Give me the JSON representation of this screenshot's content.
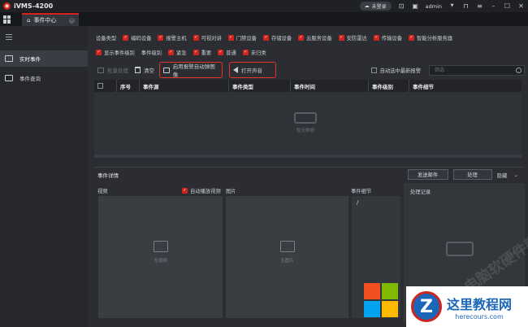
{
  "app": {
    "title": "iVMS-4200",
    "logo": "hikvision-logo"
  },
  "titlebar": {
    "login_label": "未登录",
    "user": "admin"
  },
  "tab": {
    "label": "事件中心"
  },
  "sidebar": {
    "items": [
      {
        "label": "实时事件",
        "active": true
      },
      {
        "label": "事件查询",
        "active": false
      }
    ]
  },
  "filters": {
    "device_label": "设备类型",
    "device_types": [
      "编码设备",
      "报警主机",
      "可视对讲",
      "门禁设备",
      "存储设备",
      "云服务设备",
      "安防雷达",
      "传输设备",
      "智能分析服务器"
    ],
    "level_label": "显示事件级别",
    "level_title": "事件级别",
    "levels": [
      "紧急",
      "重要",
      "普通",
      "未归类"
    ]
  },
  "toolbar": {
    "batch_handle": "批量处理",
    "clear": "清空",
    "auto_popup": "启用报警自动弹图像",
    "open_sound": "打开声音",
    "auto_select_latest": "自动选中最新报警",
    "search_placeholder": "筛选"
  },
  "table": {
    "columns": [
      "序号",
      "事件源",
      "事件类型",
      "事件时间",
      "事件级别",
      "事件细节"
    ],
    "empty_text": "暂无数据"
  },
  "detail": {
    "title": "事件详情",
    "send_email": "发送邮件",
    "handle": "处理",
    "hide": "隐藏",
    "video_label": "视频",
    "auto_play_label": "自动播放视频",
    "picture_label": "图片",
    "detail_label": "事件细节",
    "detail_value": "/",
    "no_video": "无视频",
    "no_picture": "无图片",
    "record_label": "处理记录"
  },
  "watermark": {
    "brand": "这里教程网",
    "url": "herecours.com",
    "badge_letter": "Z",
    "overlay_text": "电脑软硬件教程网"
  },
  "colors": {
    "accent": "#d0241c",
    "highlight": "#e5342b",
    "bg": "#2b2d32"
  }
}
